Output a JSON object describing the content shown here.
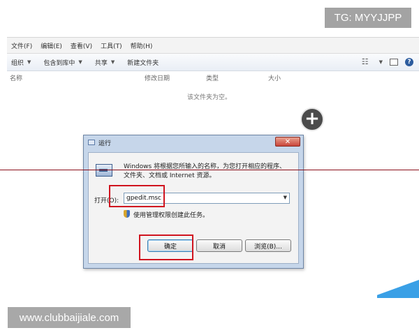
{
  "watermarks": {
    "tg": "TG: MYYJJPP",
    "site": "www.clubbaijiale.com"
  },
  "explorer": {
    "menu": [
      "文件(F)",
      "编辑(E)",
      "查看(V)",
      "工具(T)",
      "帮助(H)"
    ],
    "toolbar": {
      "organize": "组织",
      "include": "包含到库中",
      "share": "共享",
      "new_folder": "新建文件夹"
    },
    "columns": [
      "名称",
      "修改日期",
      "类型",
      "大小"
    ],
    "empty_message": "该文件夹为空。"
  },
  "run_dialog": {
    "title": "运行",
    "description": "Windows 将根据您所输入的名称，为您打开相应的程序、文件夹、文档或 Internet 资源。",
    "open_label": "打开(O):",
    "command_value": "gpedit.msc",
    "admin_note": "使用管理权限创建此任务。",
    "ok_label": "确定",
    "cancel_label": "取消",
    "browse_label": "浏览(B)...",
    "close_glyph": "✕"
  },
  "overlay": {
    "plus_glyph": "+"
  },
  "colors": {
    "highlight_red": "#d0141f",
    "dialog_frame": "#c6d6ea",
    "accent_blue": "#3aa0e6"
  }
}
